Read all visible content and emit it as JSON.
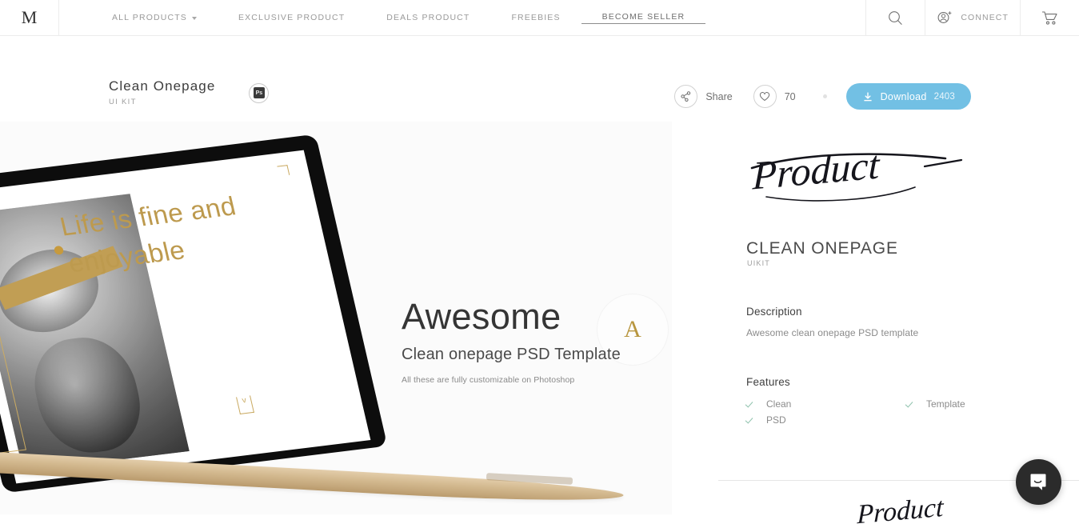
{
  "header": {
    "logo": "M",
    "nav": [
      {
        "label": "ALL PRODUCTS",
        "has_caret": true,
        "active": false
      },
      {
        "label": "EXCLUSIVE PRODUCT",
        "has_caret": false,
        "active": false
      },
      {
        "label": "DEALS PRODUCT",
        "has_caret": false,
        "active": false
      },
      {
        "label": "FREEBIES",
        "has_caret": false,
        "active": false
      },
      {
        "label": "BECOME SELLER",
        "has_caret": false,
        "active": true
      }
    ],
    "search_icon": "search-icon",
    "connect_label": "CONNECT",
    "connect_icon": "user-add-icon",
    "cart_icon": "shopping-cart-icon"
  },
  "titlebar": {
    "product_title": "Clean Onepage",
    "product_subtitle": "UI KIT",
    "format_badge": "Ps",
    "share_label": "Share",
    "share_icon": "share-icon",
    "like_icon": "heart-icon",
    "like_count": "70",
    "download_icon": "download-icon",
    "download_label": "Download",
    "download_count": "2403"
  },
  "preview": {
    "screen_heading": "Life is fine and enjoyable",
    "badge_letter": "A",
    "hero_title": "Awesome",
    "hero_subtitle": "Clean onepage PSD Template",
    "hero_note": "All these are fully customizable on Photoshop"
  },
  "detail": {
    "brand_wordmark": "Product",
    "title": "CLEAN ONEPAGE",
    "subtitle": "UIKIT",
    "description_heading": "Description",
    "description_text": "Awesome clean onepage PSD template",
    "features_heading": "Features",
    "features": [
      "Clean",
      "Template",
      "PSD"
    ]
  },
  "chat": {
    "icon": "chat-bubble-icon"
  },
  "colors": {
    "accent_blue": "#72c0e4",
    "gold": "#bd9a4e",
    "check_green": "#8fc2ad",
    "chat_dark": "#2b2b2b"
  }
}
